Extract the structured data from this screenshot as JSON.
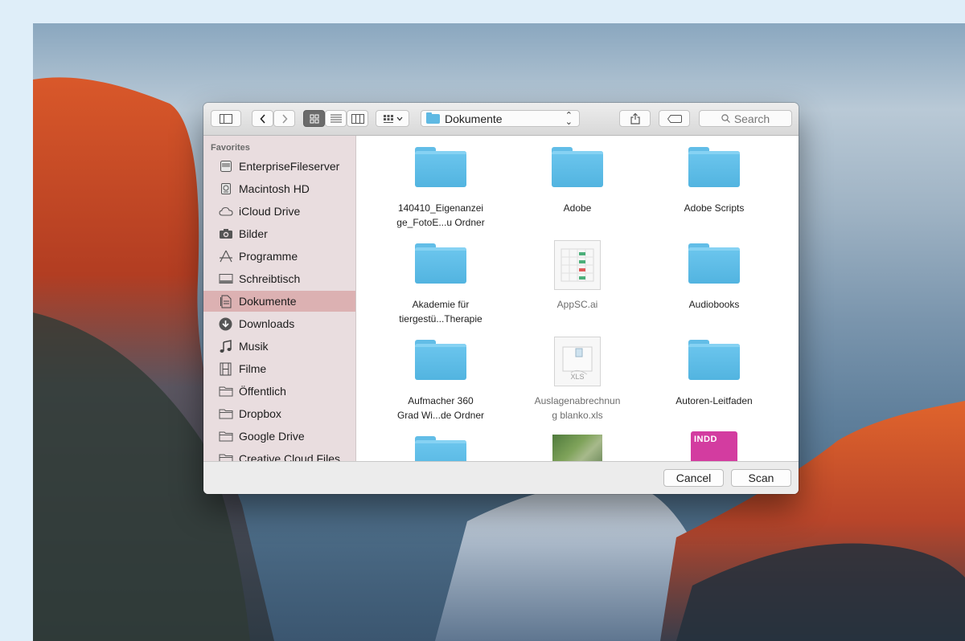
{
  "toolbar": {
    "location": "Dokumente",
    "search_placeholder": "Search"
  },
  "sidebar": {
    "header": "Favorites",
    "items": [
      {
        "label": "EnterpriseFileserver",
        "icon": "server-icon"
      },
      {
        "label": "Macintosh HD",
        "icon": "harddisk-icon"
      },
      {
        "label": "iCloud Drive",
        "icon": "cloud-icon"
      },
      {
        "label": "Bilder",
        "icon": "camera-icon"
      },
      {
        "label": "Programme",
        "icon": "apps-icon"
      },
      {
        "label": "Schreibtisch",
        "icon": "desktop-icon"
      },
      {
        "label": "Dokumente",
        "icon": "documents-icon",
        "selected": true
      },
      {
        "label": "Downloads",
        "icon": "download-icon"
      },
      {
        "label": "Musik",
        "icon": "music-icon"
      },
      {
        "label": "Filme",
        "icon": "film-icon"
      },
      {
        "label": "Öffentlich",
        "icon": "folder-icon"
      },
      {
        "label": "Dropbox",
        "icon": "folder-icon"
      },
      {
        "label": "Google Drive",
        "icon": "folder-icon"
      },
      {
        "label": "Creative Cloud Files",
        "icon": "folder-icon"
      }
    ]
  },
  "files": [
    {
      "line1": "140410_Eigenanzei",
      "line2": "ge_FotoE...u Ordner",
      "kind": "folder"
    },
    {
      "line1": "Adobe",
      "line2": "",
      "kind": "folder"
    },
    {
      "line1": "Adobe Scripts",
      "line2": "",
      "kind": "folder"
    },
    {
      "line1": "Akademie für",
      "line2": "tiergestü...Therapie",
      "kind": "folder"
    },
    {
      "line1": "AppSC.ai",
      "line2": "",
      "kind": "document",
      "dim": true
    },
    {
      "line1": "Audiobooks",
      "line2": "",
      "kind": "folder"
    },
    {
      "line1": "Aufmacher 360",
      "line2": "Grad Wi...de Ordner",
      "kind": "folder"
    },
    {
      "line1": "Auslagenabrechnun",
      "line2": "g blanko.xls",
      "kind": "spreadsheet",
      "dim": true
    },
    {
      "line1": "Autoren-Leitfaden",
      "line2": "",
      "kind": "folder"
    },
    {
      "line1": "",
      "line2": "",
      "kind": "folder"
    },
    {
      "line1": "",
      "line2": "",
      "kind": "image"
    },
    {
      "line1": "",
      "line2": "",
      "kind": "indd",
      "badge": "INDD"
    }
  ],
  "buttons": {
    "cancel": "Cancel",
    "scan": "Scan"
  },
  "colors": {
    "folder": "#5fb9e3",
    "sidebar_selection": "#d28c8c",
    "indd": "#d33ca0"
  }
}
